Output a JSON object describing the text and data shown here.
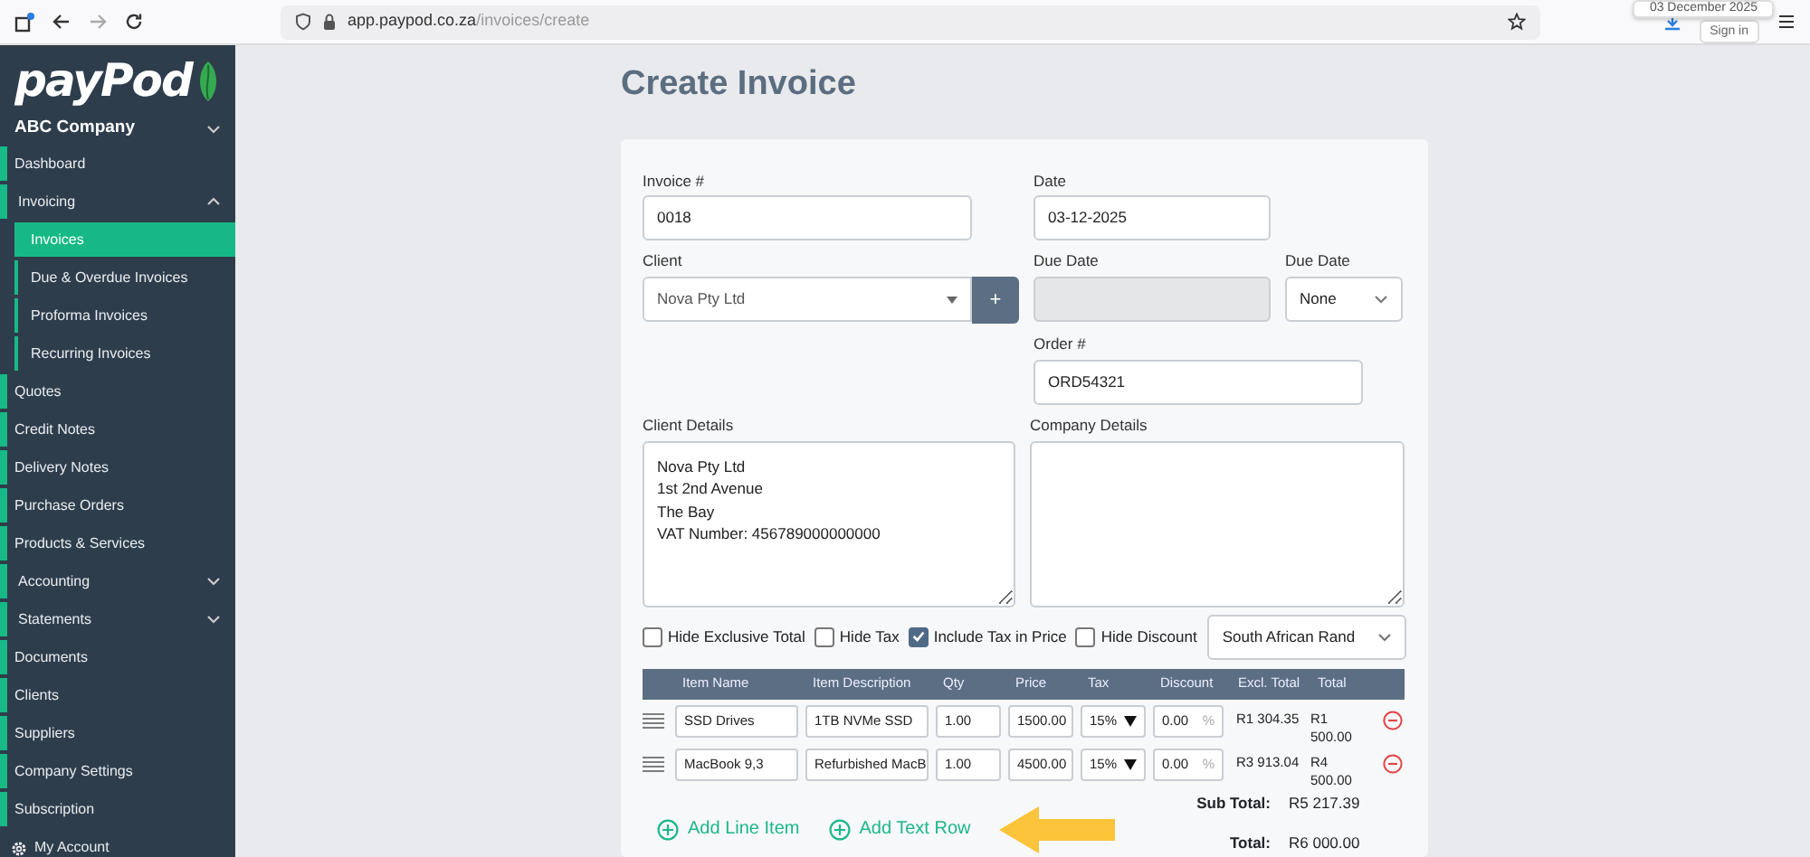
{
  "browser": {
    "host": "app.paypod.co.za",
    "path": "/invoices/create",
    "tooltip": "03 December 2025",
    "sign_in": "Sign in"
  },
  "logo": "payPod",
  "company": {
    "label": "ABC Company",
    "expanded": false
  },
  "sidebar": {
    "items": [
      {
        "label": "Dashboard",
        "selected": false
      },
      {
        "label": "Invoicing",
        "selected": false,
        "expanded": true,
        "children": [
          {
            "label": "Invoices",
            "selected": true
          },
          {
            "label": "Due & Overdue Invoices",
            "selected": false
          },
          {
            "label": "Proforma Invoices",
            "selected": false
          },
          {
            "label": "Recurring Invoices",
            "selected": false
          }
        ]
      },
      {
        "label": "Quotes",
        "selected": false
      },
      {
        "label": "Credit Notes",
        "selected": false
      },
      {
        "label": "Delivery Notes",
        "selected": false
      },
      {
        "label": "Purchase Orders",
        "selected": false
      },
      {
        "label": "Products & Services",
        "selected": false
      },
      {
        "label": "Accounting",
        "selected": false,
        "expanded": false
      },
      {
        "label": "Statements",
        "selected": false,
        "expanded": false
      },
      {
        "label": "Documents",
        "selected": false
      },
      {
        "label": "Clients",
        "selected": false
      },
      {
        "label": "Suppliers",
        "selected": false
      },
      {
        "label": "Company Settings",
        "selected": false
      },
      {
        "label": "Subscription",
        "selected": false
      }
    ],
    "account": "My Account"
  },
  "page_title": "Create Invoice",
  "form": {
    "invoice_number": {
      "label": "Invoice #",
      "value": "0018"
    },
    "date": {
      "label": "Date",
      "value": "03-12-2025"
    },
    "client": {
      "label": "Client",
      "value": "Nova Pty Ltd",
      "add": "+"
    },
    "due_date": {
      "label": "Due Date",
      "disabled": true
    },
    "due_term": {
      "label": "Due Date",
      "value": "None"
    },
    "order_number": {
      "label": "Order #",
      "value": "ORD54321"
    },
    "client_details": {
      "label": "Client Details",
      "value": "Nova Pty Ltd\n1st 2nd Avenue\nThe Bay\nVAT Number: 456789000000000"
    },
    "company_details": {
      "label": "Company Details"
    },
    "options": [
      {
        "label": "Hide Exclusive Total",
        "checked": false
      },
      {
        "label": "Hide Tax",
        "checked": false
      },
      {
        "label": "Include Tax in Price",
        "checked": true
      },
      {
        "label": "Hide Discount",
        "checked": false
      }
    ],
    "currency": {
      "value": "South African Rand"
    }
  },
  "table": {
    "columns": [
      "Item Name",
      "Item Description",
      "Qty",
      "Price",
      "Tax",
      "Discount",
      "Excl. Total",
      "Total"
    ],
    "rows": [
      {
        "item_name": "SSD Drives",
        "description": "1TB NVMe SSD",
        "qty": "1.00",
        "price": "1500.00",
        "tax": "15%",
        "discount": "0.00",
        "discount_unit": "%",
        "excl_total": "R1 304.35",
        "total": "R1 500.00"
      },
      {
        "item_name": "MacBook 9,3",
        "description": "Refurbished MacB",
        "qty": "1.00",
        "price": "4500.00",
        "tax": "15%",
        "discount": "0.00",
        "discount_unit": "%",
        "excl_total": "R3 913.04",
        "total": "R4 500.00"
      }
    ]
  },
  "actions": [
    "Add Line Item",
    "Add Text Row"
  ],
  "totals": [
    {
      "label": "Sub Total:",
      "value": "R5 217.39"
    },
    {
      "label": "Total:",
      "value": "R6 000.00"
    }
  ]
}
